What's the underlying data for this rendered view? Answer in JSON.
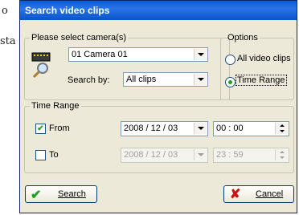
{
  "background": {
    "text_top": "o",
    "text_mid": "sta"
  },
  "dialog": {
    "title": "Search video clips"
  },
  "camera_group": {
    "legend": "Please select camera(s)",
    "camera_value": "01 Camera 01",
    "search_by_label": "Search by:",
    "search_by_value": "All clips"
  },
  "options_group": {
    "legend": "Options",
    "all_clips_label": "All video clips",
    "time_range_label": "Time Range",
    "selected": "time_range"
  },
  "time_range_group": {
    "legend": "Time Range",
    "from_label": "From",
    "from_checked": true,
    "from_date": "2008 / 12 / 03",
    "from_time": "00 :  00",
    "to_label": "To",
    "to_checked": false,
    "to_date": "2008 / 12 / 03",
    "to_time": "23 :  59"
  },
  "buttons": {
    "search_label": "Search",
    "cancel_label": "Cancel"
  },
  "colors": {
    "titlebar": "#0a5bd8",
    "dialog_bg": "#ece9d8",
    "check_green": "#21a121",
    "cancel_red": "#cc1111"
  }
}
